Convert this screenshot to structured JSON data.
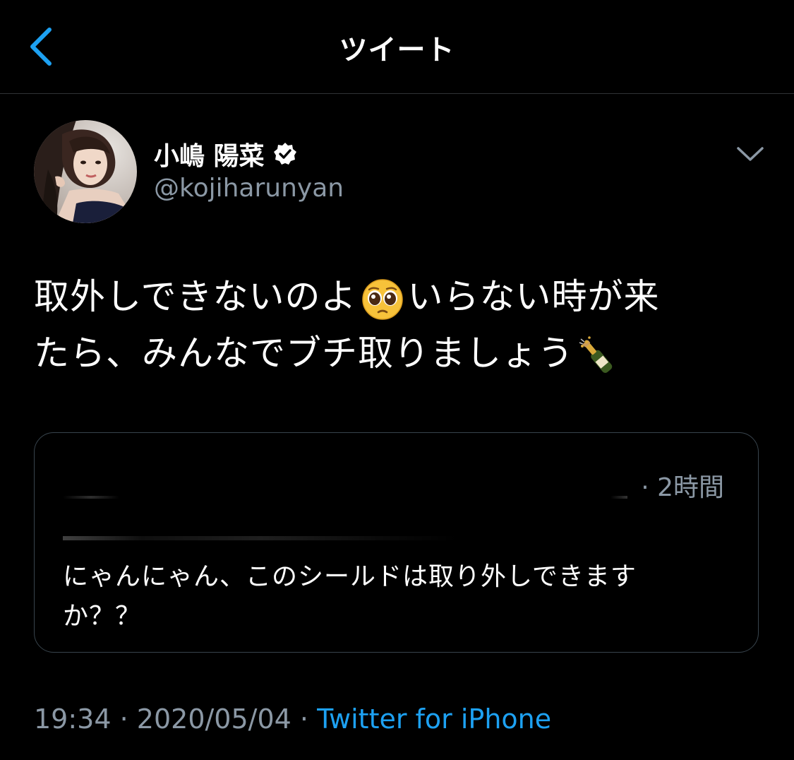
{
  "header": {
    "title": "ツイート",
    "back_icon": "chevron-left-icon"
  },
  "tweet": {
    "display_name": "小嶋 陽菜",
    "handle": "@kojiharunyan",
    "verified_icon": "verified-badge-icon",
    "more_icon": "chevron-down-icon",
    "text_line1_a": "取外しできないのよ",
    "text_line1_emoji": "pleading-face-emoji",
    "text_line1_b": "いらない時が来",
    "text_line2": "たら、みんなでブチ取りましょう",
    "text_line2_emoji": "champagne-bottle-emoji",
    "timestamp": "19:34",
    "date": "2020/05/04",
    "separator": "·",
    "source": "Twitter for iPhone"
  },
  "quote": {
    "time": "· 2時間",
    "text_line1": "にゃんにゃん、このシールドは取り外しできます",
    "text_line2": "か？？"
  },
  "colors": {
    "background": "#000000",
    "text": "#ffffff",
    "secondary": "#8b98a5",
    "accent": "#1da1f2",
    "border": "#38444d"
  }
}
